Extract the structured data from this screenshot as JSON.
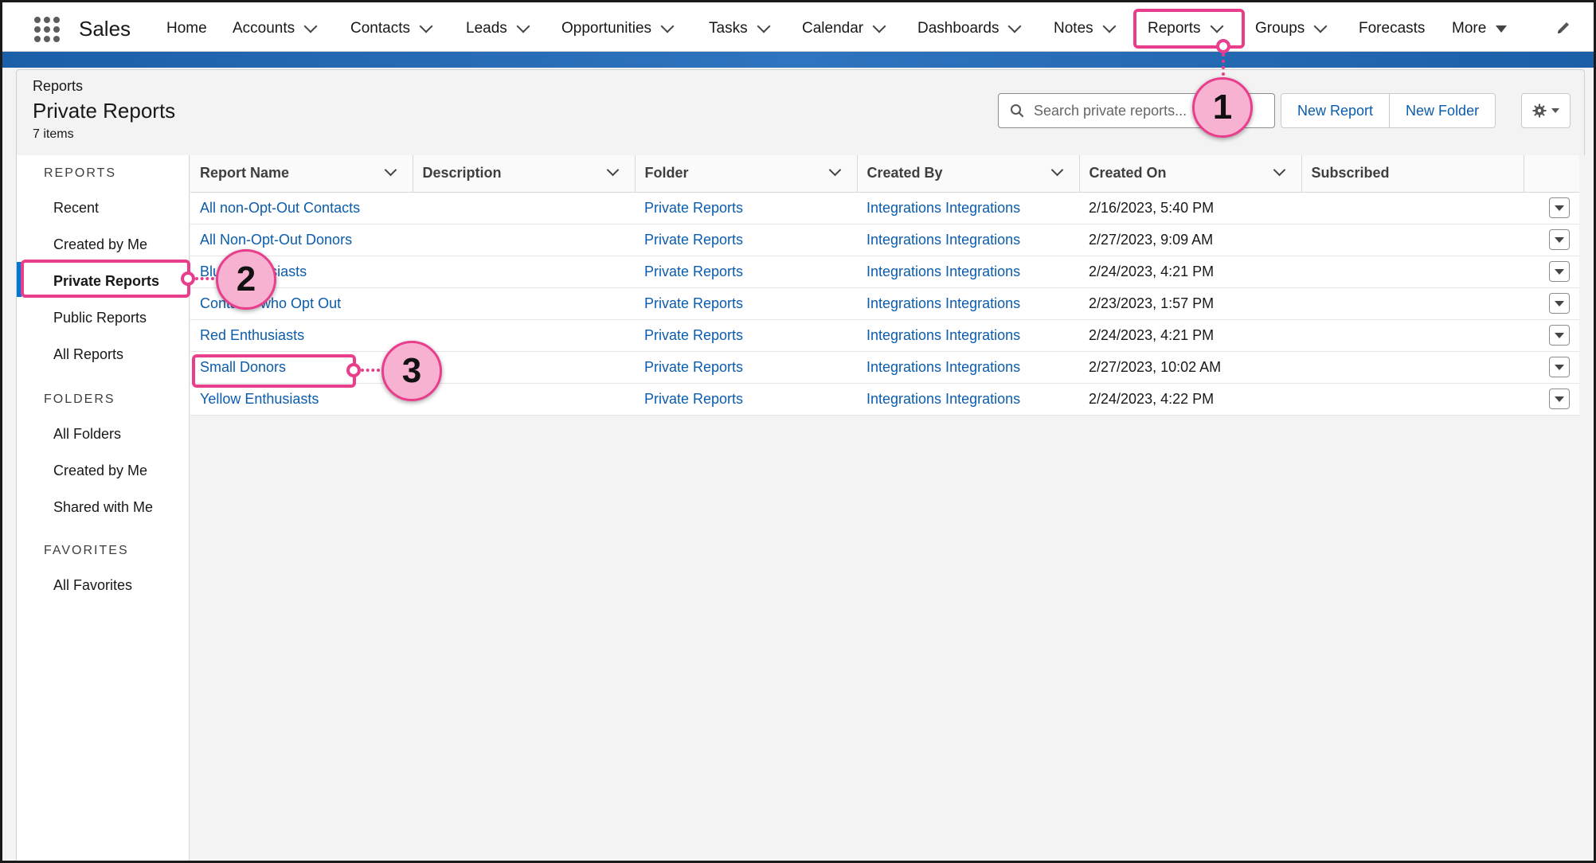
{
  "app": {
    "name": "Sales"
  },
  "nav": {
    "home": "Home",
    "accounts": "Accounts",
    "contacts": "Contacts",
    "leads": "Leads",
    "opportunities": "Opportunities",
    "tasks": "Tasks",
    "calendar": "Calendar",
    "dashboards": "Dashboards",
    "notes": "Notes",
    "reports": "Reports",
    "groups": "Groups",
    "forecasts": "Forecasts",
    "more": "More"
  },
  "header": {
    "breadcrumb": "Reports",
    "title": "Private Reports",
    "count": "7 items",
    "search_placeholder": "Search private reports...",
    "new_report": "New Report",
    "new_folder": "New Folder"
  },
  "sidebar": {
    "reports_heading": "REPORTS",
    "recent": "Recent",
    "created_by_me": "Created by Me",
    "private_reports": "Private Reports",
    "public_reports": "Public Reports",
    "all_reports": "All Reports",
    "folders_heading": "FOLDERS",
    "all_folders": "All Folders",
    "folders_created_by_me": "Created by Me",
    "shared_with_me": "Shared with Me",
    "favorites_heading": "FAVORITES",
    "all_favorites": "All Favorites"
  },
  "table": {
    "columns": {
      "report_name": "Report Name",
      "description": "Description",
      "folder": "Folder",
      "created_by": "Created By",
      "created_on": "Created On",
      "subscribed": "Subscribed"
    },
    "rows": [
      {
        "name": "All non-Opt-Out Contacts",
        "description": "",
        "folder": "Private Reports",
        "created_by": "Integrations Integrations",
        "created_on": "2/16/2023, 5:40 PM"
      },
      {
        "name": "All Non-Opt-Out Donors",
        "description": "",
        "folder": "Private Reports",
        "created_by": "Integrations Integrations",
        "created_on": "2/27/2023, 9:09 AM"
      },
      {
        "name": "Blue Enthusiasts",
        "description": "",
        "folder": "Private Reports",
        "created_by": "Integrations Integrations",
        "created_on": "2/24/2023, 4:21 PM"
      },
      {
        "name": "Contacts who Opt Out",
        "description": "",
        "folder": "Private Reports",
        "created_by": "Integrations Integrations",
        "created_on": "2/23/2023, 1:57 PM"
      },
      {
        "name": "Red Enthusiasts",
        "description": "",
        "folder": "Private Reports",
        "created_by": "Integrations Integrations",
        "created_on": "2/24/2023, 4:21 PM"
      },
      {
        "name": "Small Donors",
        "description": "",
        "folder": "Private Reports",
        "created_by": "Integrations Integrations",
        "created_on": "2/27/2023, 10:02 AM"
      },
      {
        "name": "Yellow Enthusiasts",
        "description": "",
        "folder": "Private Reports",
        "created_by": "Integrations Integrations",
        "created_on": "2/24/2023, 4:22 PM"
      }
    ]
  },
  "annotations": {
    "step1": "1",
    "step2": "2",
    "step3": "3"
  },
  "colors": {
    "accent": "#0176d3",
    "link": "#0b5cab",
    "highlight": "#e83e8c",
    "callout_fill": "#f7b2d1"
  },
  "icons": {
    "app_launcher": "waffle-icon",
    "search": "search-icon",
    "settings": "gear-icon",
    "edit": "pencil-icon",
    "row_actions": "chevron-down-icon"
  }
}
